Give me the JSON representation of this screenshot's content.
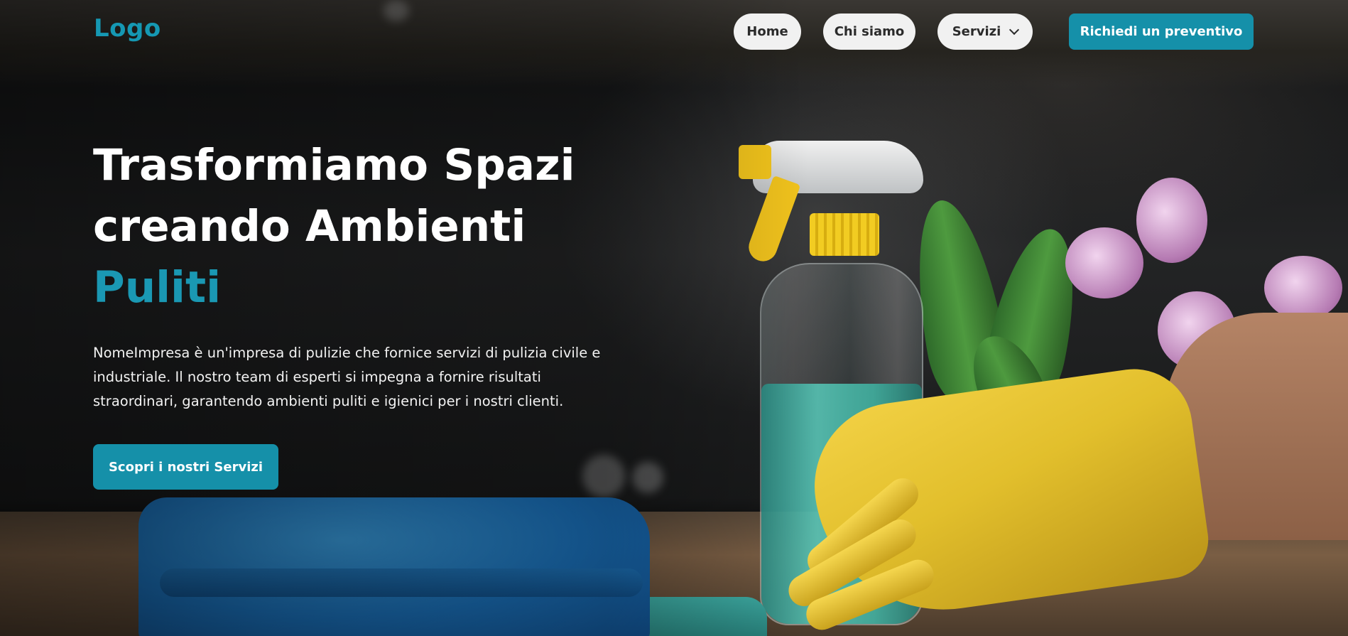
{
  "header": {
    "logo": "Logo",
    "nav": [
      {
        "label": "Home"
      },
      {
        "label": "Chi siamo"
      },
      {
        "label": "Servizi"
      }
    ],
    "cta_label": "Richiedi un preventivo"
  },
  "hero": {
    "title_line1": "Trasformiamo Spazi",
    "title_line2": "creando Ambienti",
    "title_accent": "Puliti",
    "description": "NomeImpresa è un'impresa di pulizie che fornice servizi di pulizia civile e industriale. Il nostro team di esperti si impegna a fornire risultati straordinari, garantendo ambienti puliti e igienici per i nostri clienti.",
    "cta_label": "Scopri i nostri Servizi"
  },
  "colors": {
    "accent": "#1590a9",
    "logo": "#1598b3",
    "nav_pill_bg": "#f1f1f1",
    "text_light": "#ffffff"
  },
  "icons": {
    "servizi_dropdown": "chevron-down-icon"
  }
}
